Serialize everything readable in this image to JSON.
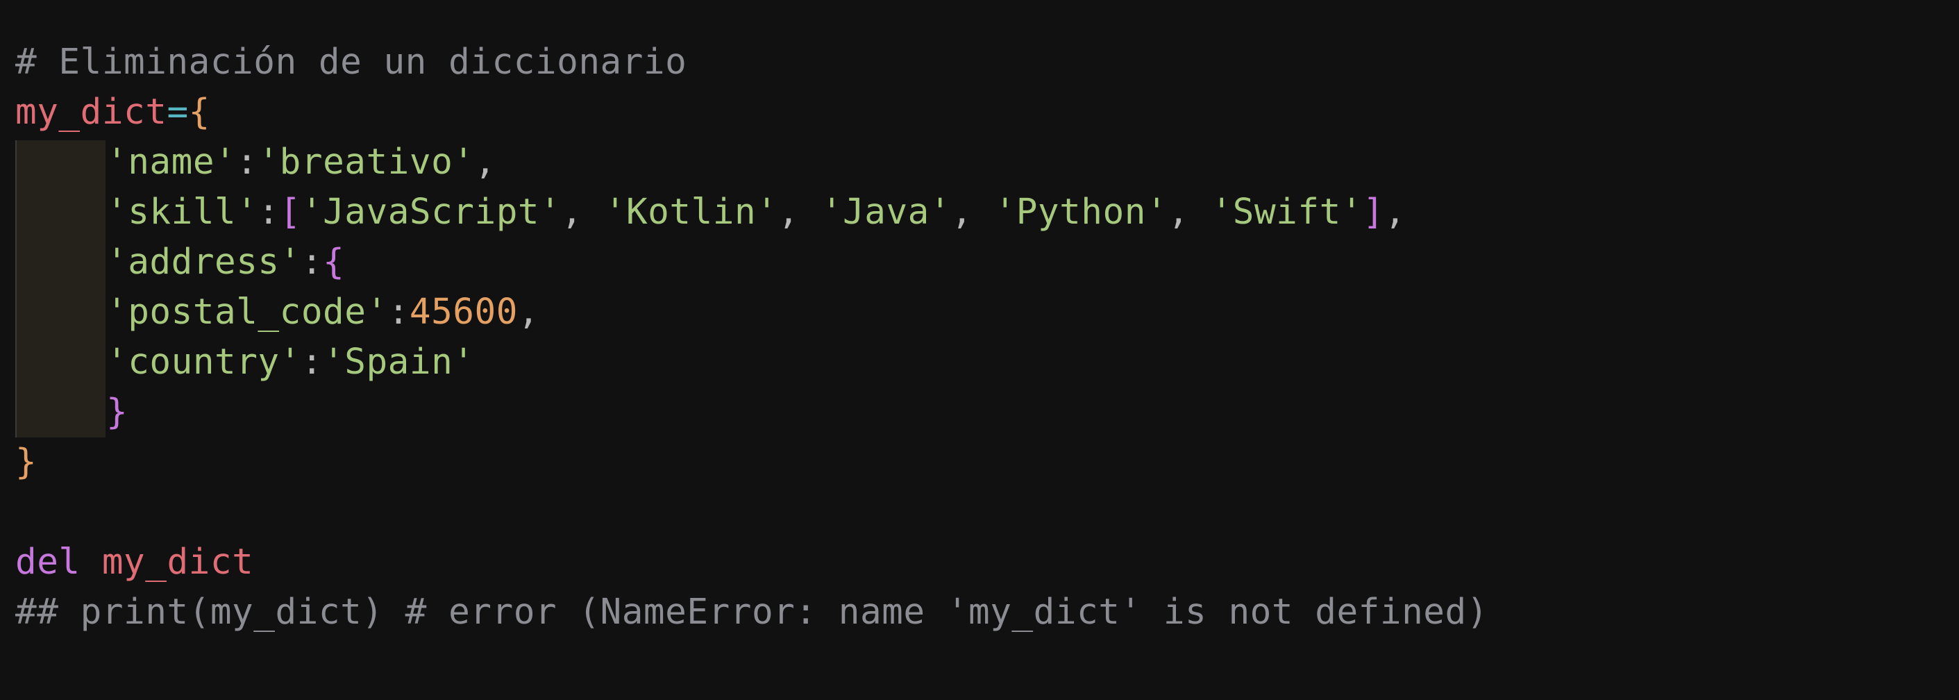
{
  "code": {
    "comment_title": "# Eliminación de un diccionario",
    "var_name": "my_dict",
    "assign_op": "=",
    "open_brace": "{",
    "close_brace": "}",
    "entries": {
      "name_key": "'name'",
      "name_val": "'breativo'",
      "skill_key": "'skill'",
      "skills": [
        "'JavaScript'",
        "'Kotlin'",
        "'Java'",
        "'Python'",
        "'Swift'"
      ],
      "address_key": "'address'",
      "postal_key": "'postal_code'",
      "postal_val": "45600",
      "country_key": "'country'",
      "country_val": "'Spain'"
    },
    "del_keyword": "del",
    "del_target": "my_dict",
    "comment_print": "## print(my_dict) # error (NameError: name 'my_dict' is not defined)"
  },
  "colors": {
    "background": "#111112",
    "comment": "#8b8d93",
    "variable": "#e06c75",
    "operator": "#56b6c2",
    "brace": "#e5a063",
    "bracket": "#c678dd",
    "string": "#a7c97e",
    "number": "#e5a063",
    "keyword": "#c678dd",
    "indent_highlight": "#24221a"
  }
}
